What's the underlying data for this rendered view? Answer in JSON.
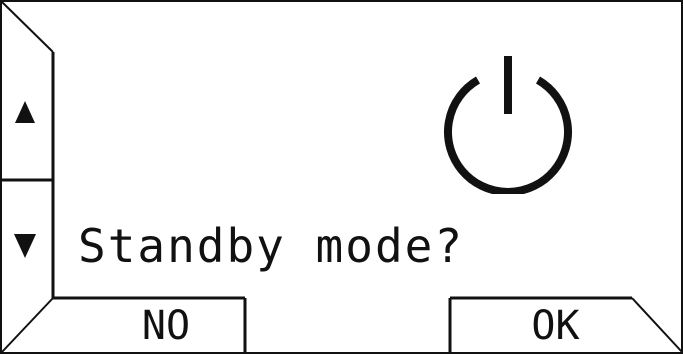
{
  "dialog": {
    "prompt": "Standby mode?",
    "icon": "power-icon"
  },
  "softkeys": {
    "no_label": "NO",
    "ok_label": "OK"
  },
  "scroll": {
    "up_icon": "triangle-up-icon",
    "down_icon": "triangle-down-icon"
  },
  "colors": {
    "foreground": "#111111",
    "background": "#ffffff"
  }
}
